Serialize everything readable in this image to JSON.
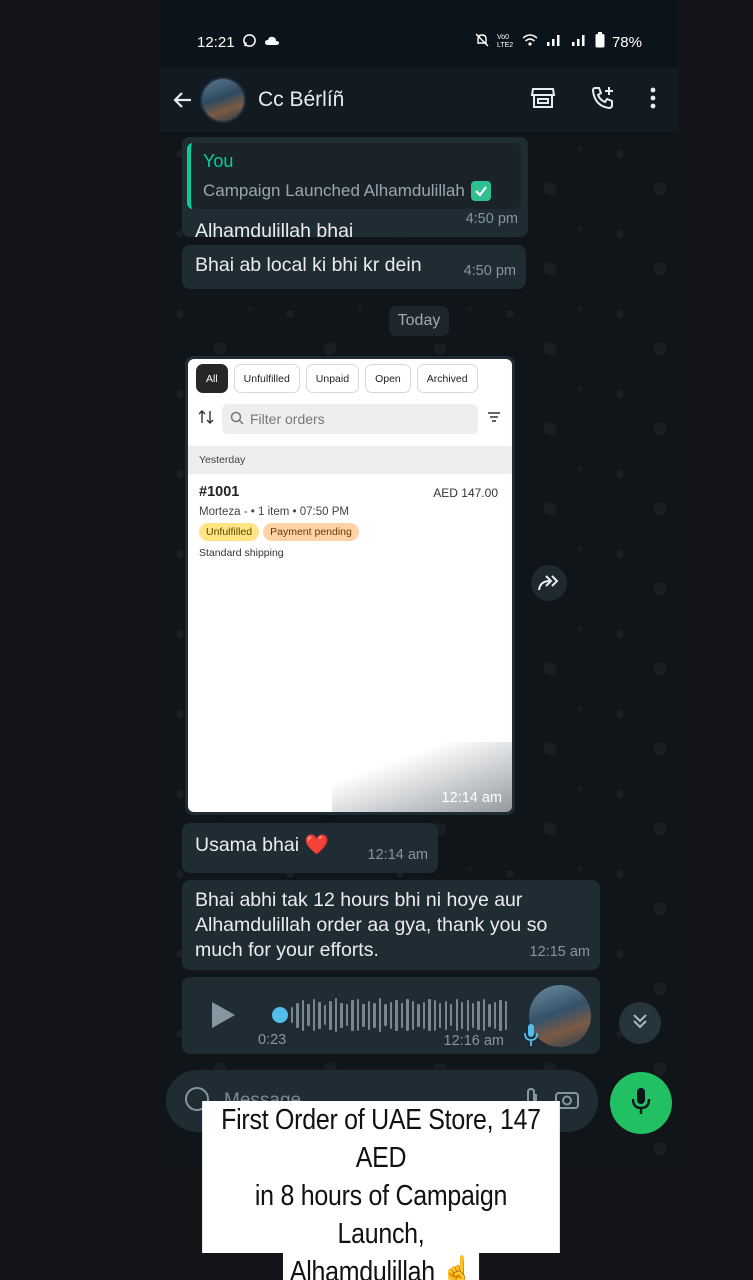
{
  "status_bar": {
    "time": "12:21",
    "battery": "78%",
    "network_label": "Vo0 LTE2"
  },
  "header": {
    "contact_name": "Cc Bérlíñ"
  },
  "messages": [
    {
      "quote_author": "You",
      "quote_text": "Campaign Launched Alhamdulillah",
      "text": "Alhamdulillah bhai",
      "time": "4:50 pm"
    },
    {
      "text": "Bhai ab local ki bhi kr dein",
      "time": "4:50 pm"
    }
  ],
  "day_divider": "Today",
  "image_message": {
    "time": "12:14 am",
    "screenshot": {
      "tabs": [
        "All",
        "Unfulfilled",
        "Unpaid",
        "Open",
        "Archived"
      ],
      "filter_placeholder": "Filter orders",
      "section": "Yesterday",
      "order": {
        "id": "#1001",
        "amount": "AED 147.00",
        "meta": "Morteza - • 1 item • 07:50 PM",
        "badges": [
          "Unfulfilled",
          "Payment pending"
        ],
        "shipping": "Standard shipping"
      }
    }
  },
  "messages_after": [
    {
      "text": "Usama bhai ❤️",
      "time": "12:14 am"
    },
    {
      "text": "Bhai abhi tak 12 hours bhi ni hoye aur Alhamdulillah order aa gya, thank you so much for your efforts.",
      "time": "12:15 am"
    }
  ],
  "voice_note": {
    "duration": "0:23",
    "time": "12:16 am",
    "levels": [
      0.45,
      0.7,
      0.85,
      0.6,
      0.9,
      0.75,
      0.55,
      0.8,
      0.95,
      0.7,
      0.6,
      0.85,
      0.9,
      0.65,
      0.8,
      0.7,
      0.95,
      0.6,
      0.75,
      0.85,
      0.7,
      0.9,
      0.8,
      0.65,
      0.75,
      0.9,
      0.85,
      0.7,
      0.8,
      0.6,
      0.9,
      0.75,
      0.85,
      0.7,
      0.8,
      0.9,
      0.65,
      0.75,
      0.85,
      0.8
    ]
  },
  "composer": {
    "placeholder": "Message"
  },
  "caption": {
    "lines": [
      "First Order of UAE Store, 147 AED",
      "in 8 hours of Campaign Launch,",
      "Alhamdulillah ☝️"
    ]
  },
  "colors": {
    "accent_green": "#21c063",
    "quote_green": "#06cf9c",
    "bubble": "#202c33",
    "voice_dot": "#53bdeb"
  }
}
